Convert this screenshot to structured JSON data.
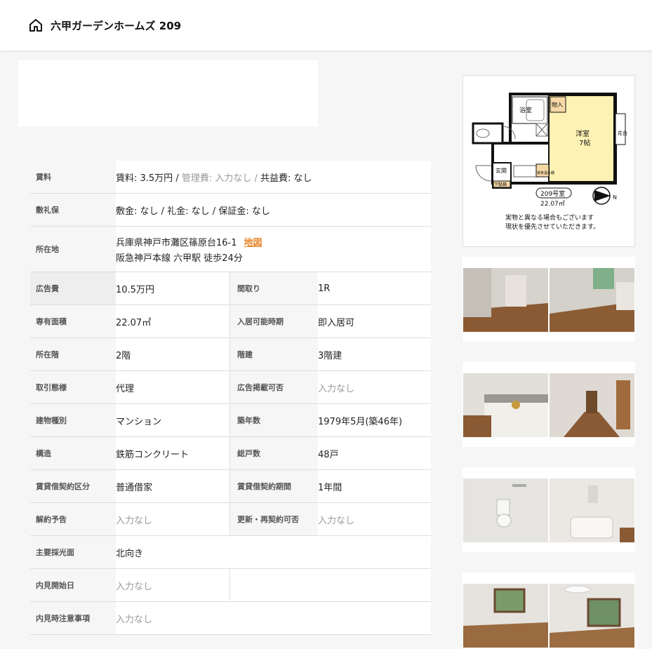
{
  "header": {
    "title": "六甲ガーデンホームズ 209"
  },
  "details": {
    "rent": {
      "label": "賃料",
      "rent_text": "賃料: 3.5万円 /",
      "mgmt_text": "管理費: 入力なし /",
      "common_text": "共益費: なし"
    },
    "deposit": {
      "label": "敷礼保",
      "value": "敷金: なし / 礼金: なし / 保証金: なし"
    },
    "location": {
      "label": "所在地",
      "address": "兵庫県神戸市灘区篠原台16-1",
      "map_link": "地図",
      "access": "阪急神戸本線 六甲駅 徒歩24分"
    },
    "rows": [
      {
        "l1": "広告費",
        "v1": "10.5万円",
        "l2": "間取り",
        "v2": "1R"
      },
      {
        "l1": "専有面積",
        "v1": "22.07㎡",
        "l2": "入居可能時期",
        "v2": "即入居可"
      },
      {
        "l1": "所在階",
        "v1": "2階",
        "l2": "階建",
        "v2": "3階建"
      },
      {
        "l1": "取引態様",
        "v1": "代理",
        "l2": "広告掲載可否",
        "v2": "入力なし"
      },
      {
        "l1": "建物種別",
        "v1": "マンション",
        "l2": "築年数",
        "v2": "1979年5月(築46年)"
      },
      {
        "l1": "構造",
        "v1": "鉄筋コンクリート",
        "l2": "総戸数",
        "v2": "48戸"
      },
      {
        "l1": "賃貸借契約区分",
        "v1": "普通借家",
        "l2": "賃貸借契約期間",
        "v2": "1年間"
      },
      {
        "l1": "解約予告",
        "v1": "入力なし",
        "l2": "更新・再契約可否",
        "v2": "入力なし"
      }
    ],
    "lighting": {
      "label": "主要採光面",
      "value": "北向き"
    },
    "viewing_start": {
      "label": "内見開始日",
      "value": "入力なし"
    },
    "viewing_notes": {
      "label": "内見時注意事項",
      "value": "入力なし"
    }
  },
  "floorplan": {
    "bath": "浴室",
    "storage": "物入",
    "western_room": "洋室",
    "size": "7帖",
    "flower": "花台",
    "entrance": "玄関",
    "shoebox": "下駄箱",
    "water_heater": "電気温水器",
    "room_no": "209号室",
    "area": "22.07㎡",
    "north": "N",
    "note1": "実物と異なる場合もございます",
    "note2": "現状を優先させていただきます。"
  },
  "colors": {
    "accent": "#e8842a",
    "room_fill": "#fdf2b4",
    "grey_text": "#999999"
  }
}
